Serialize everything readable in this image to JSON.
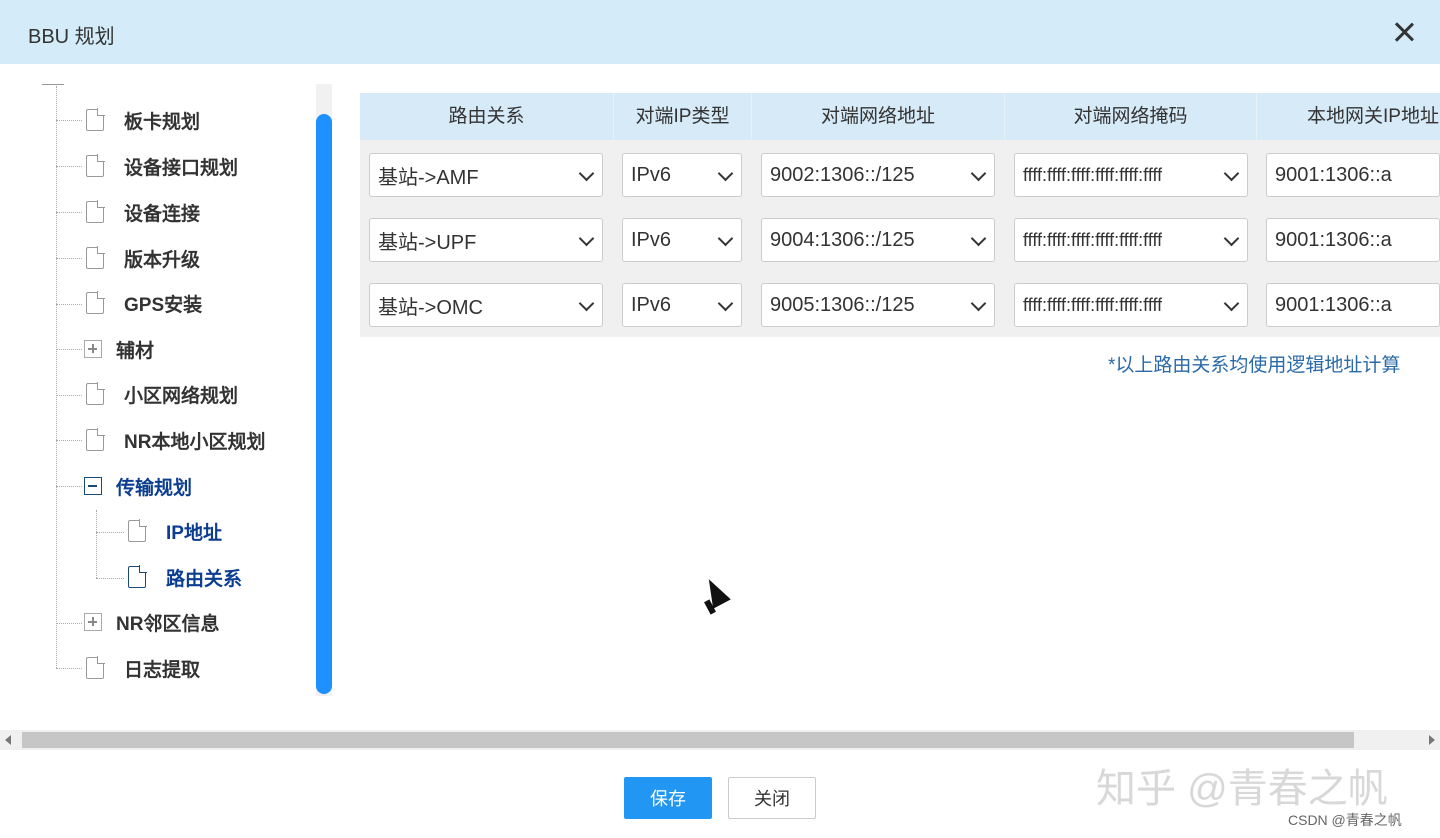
{
  "dialog": {
    "title": "BBU 规划"
  },
  "tree": {
    "items": [
      {
        "label": "板卡规划",
        "icon": "document-icon"
      },
      {
        "label": "设备接口规划",
        "icon": "document-icon"
      },
      {
        "label": "设备连接",
        "icon": "document-icon"
      },
      {
        "label": "版本升级",
        "icon": "document-icon"
      },
      {
        "label": "GPS安装",
        "icon": "document-icon"
      },
      {
        "label": "辅材",
        "icon": "expand-icon"
      },
      {
        "label": "小区网络规划",
        "icon": "document-icon"
      },
      {
        "label": "NR本地小区规划",
        "icon": "document-icon"
      },
      {
        "label": "传输规划",
        "icon": "collapse-icon",
        "expanded": true
      },
      {
        "label": "IP地址",
        "icon": "document-icon"
      },
      {
        "label": "路由关系",
        "icon": "document-icon",
        "selected": true
      },
      {
        "label": "NR邻区信息",
        "icon": "expand-icon"
      },
      {
        "label": "日志提取",
        "icon": "document-icon"
      }
    ]
  },
  "table": {
    "headers": [
      "路由关系",
      "对端IP类型",
      "对端网络地址",
      "对端网络掩码",
      "本地网关IP地址"
    ],
    "rows": [
      {
        "route": "基站->AMF",
        "ip_type": "IPv6",
        "peer_addr": "9002:1306::/125",
        "peer_mask": "ffff:ffff:ffff:ffff:ffff:ffff",
        "gateway": "9001:1306::a"
      },
      {
        "route": "基站->UPF",
        "ip_type": "IPv6",
        "peer_addr": "9004:1306::/125",
        "peer_mask": "ffff:ffff:ffff:ffff:ffff:ffff",
        "gateway": "9001:1306::a"
      },
      {
        "route": "基站->OMC",
        "ip_type": "IPv6",
        "peer_addr": "9005:1306::/125",
        "peer_mask": "ffff:ffff:ffff:ffff:ffff:ffff",
        "gateway": "9001:1306::a"
      }
    ],
    "note": "*以上路由关系均使用逻辑地址计算"
  },
  "buttons": {
    "save": "保存",
    "close": "关闭"
  },
  "watermark": {
    "zhihu": "知乎 @青春之帆",
    "csdn": "CSDN @青春之帆"
  },
  "colors": {
    "title_bar": "#d4ecf9",
    "header": "#d6eaf8",
    "accent": "#2196f3",
    "scroll_thumb": "#1e90ff",
    "selected_text": "#0b3d91"
  }
}
